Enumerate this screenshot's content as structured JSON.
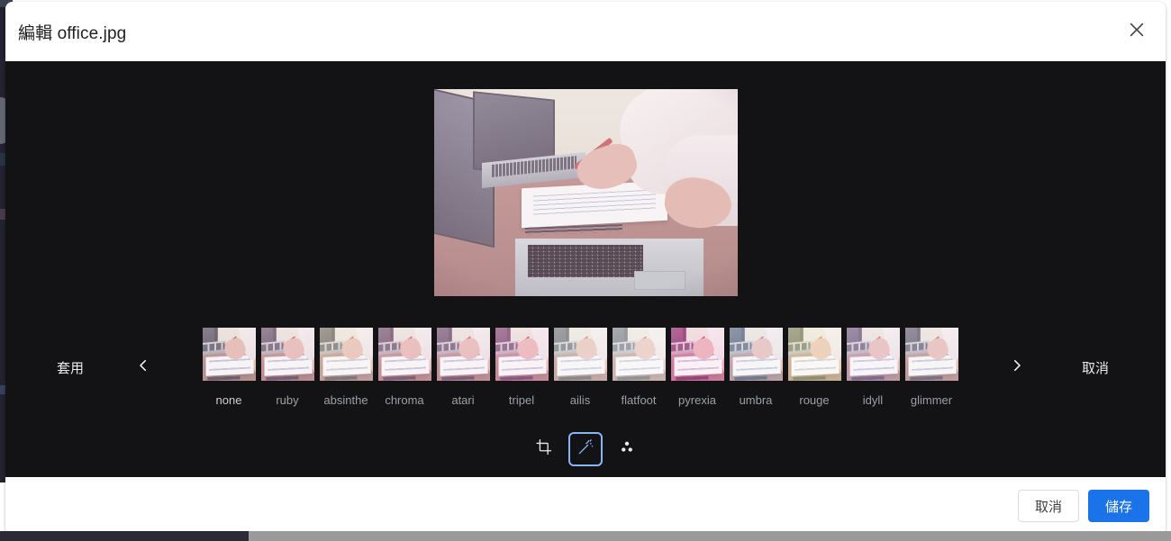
{
  "dialog": {
    "title": "編輯 office.jpg",
    "close_icon": "close-icon"
  },
  "preview": {
    "alt": "office.jpg preview"
  },
  "filmstrip": {
    "apply_label": "套用",
    "cancel_label": "取消",
    "prev_icon": "chevron-left-icon",
    "next_icon": "chevron-right-icon",
    "selected_index": 0,
    "filters": [
      {
        "name": "none"
      },
      {
        "name": "ruby"
      },
      {
        "name": "absinthe"
      },
      {
        "name": "chroma"
      },
      {
        "name": "atari"
      },
      {
        "name": "tripel"
      },
      {
        "name": "ailis"
      },
      {
        "name": "flatfoot"
      },
      {
        "name": "pyrexia"
      },
      {
        "name": "umbra"
      },
      {
        "name": "rouge"
      },
      {
        "name": "idyll"
      },
      {
        "name": "glimmer"
      }
    ]
  },
  "toolbar": {
    "tools": [
      {
        "id": "crop",
        "icon": "crop-icon",
        "active": false
      },
      {
        "id": "filters",
        "icon": "magic-wand-icon",
        "active": true
      },
      {
        "id": "adjust",
        "icon": "adjust-dots-icon",
        "active": false
      }
    ]
  },
  "footer": {
    "cancel_label": "取消",
    "save_label": "儲存"
  },
  "colors": {
    "accent": "#1a73e8",
    "accent_light": "#8ab4f8",
    "editor_bg": "#131316",
    "surface": "#ffffff",
    "label": "#9aa0a6",
    "title": "#202124"
  }
}
